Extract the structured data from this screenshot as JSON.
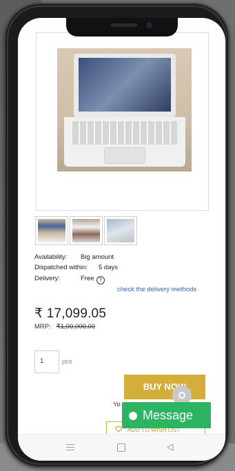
{
  "product": {
    "availability_label": "Availability:",
    "availability_value": "Big amount",
    "dispatch_label": "Dispatched within:",
    "dispatch_value": "5 days",
    "delivery_label": "Delivery:",
    "delivery_value": "Free",
    "delivery_info_glyph": "?",
    "delivery_methods_link": "check the delivery methods",
    "price": "₹ 17,099.05",
    "mrp_label": "MRP:",
    "mrp_value": "₹1,00,000.00"
  },
  "quantity": {
    "value": "1",
    "unit": "pcs"
  },
  "actions": {
    "buy_now": "BUY NOW",
    "you_text": "Yo",
    "wish_list": "ADD TO WISH LIST",
    "message": "Message"
  },
  "icons": {
    "info": "info-circle-icon",
    "heart": "heart-icon",
    "chat": "chat-bubble-icon",
    "nav_menu": "menu-icon",
    "nav_home": "home-square-icon",
    "nav_back": "back-triangle-icon"
  },
  "colors": {
    "buy_button": "#d4ae3b",
    "message_button": "#2db463",
    "link": "#2f63c7"
  }
}
